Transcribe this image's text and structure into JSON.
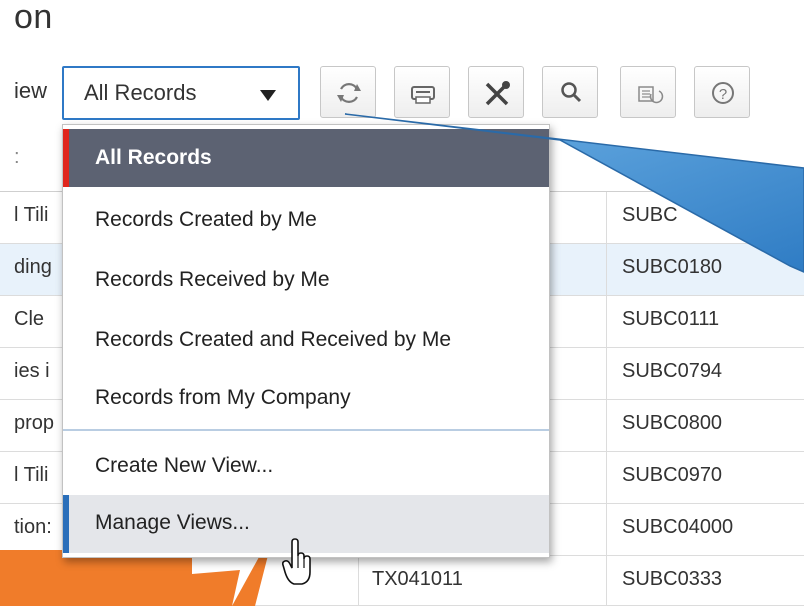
{
  "page": {
    "title": "on"
  },
  "toolbar": {
    "view_label": "iew",
    "view_select_value": "All Records",
    "buttons": [
      {
        "icon": "refresh-icon"
      },
      {
        "icon": "print-icon"
      },
      {
        "icon": "tools-icon"
      },
      {
        "icon": "search-icon"
      },
      {
        "icon": "export-icon"
      },
      {
        "icon": "help-icon"
      }
    ]
  },
  "dropdown": {
    "items": [
      "All Records",
      "Records Created by Me",
      "Records Received by Me",
      "Records Created and Received by Me",
      "Records from My Company",
      "Create New View...",
      "Manage Views..."
    ],
    "active_index": 0,
    "hover_index": 6
  },
  "table": {
    "header": [
      ":"
    ],
    "rows": [
      {
        "a": "l Tili",
        "b": "",
        "c": "SUBC"
      },
      {
        "a": "ding",
        "b": "",
        "c": "SUBC0180"
      },
      {
        "a": "Cle",
        "b": "",
        "c": "SUBC0111"
      },
      {
        "a": "ies i",
        "b": "",
        "c": "SUBC0794"
      },
      {
        "a": "prop",
        "b": "",
        "c": "SUBC0800"
      },
      {
        "a": "l Tili",
        "b": "",
        "c": "SUBC0970"
      },
      {
        "a": "tion:",
        "b": "",
        "c": "SUBC04000"
      },
      {
        "a": "",
        "b": "TX041011",
        "c": "SUBC0333"
      }
    ]
  },
  "colors": {
    "accent_blue": "#2f79c6",
    "menu_active": "#5c6272",
    "marker_red": "#e0261d",
    "callout_blue": "#3f8fcf",
    "callout_orange": "#f07c2a"
  }
}
